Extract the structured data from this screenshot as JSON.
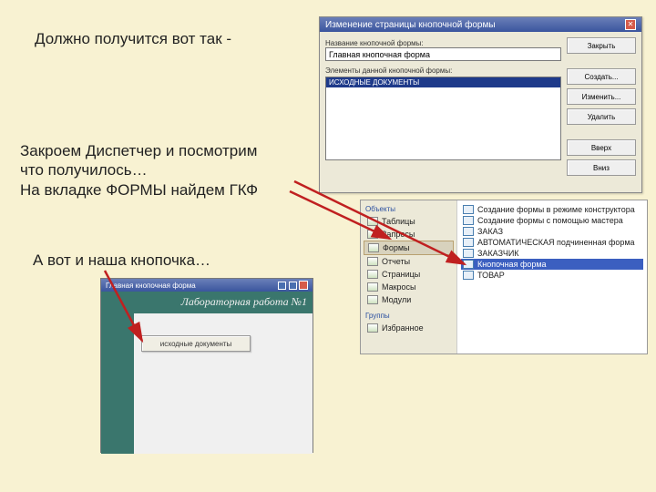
{
  "text": {
    "line1": "Должно получится вот так -",
    "line2a": "Закроем Диспетчер и посмотрим",
    "line2b": "что получилось…",
    "line2c": "На вкладке ФОРМЫ найдем ГКФ",
    "line3": "А вот и наша кнопочка…"
  },
  "dialog": {
    "title": "Изменение страницы кнопочной формы",
    "label1": "Название кнопочной формы:",
    "value1": "Главная кнопочная форма",
    "label2": "Элементы данной кнопочной формы:",
    "listItem": "ИСХОДНЫЕ ДОКУМЕНТЫ",
    "buttons": [
      "Закрыть",
      "Создать...",
      "Изменить...",
      "Удалить",
      "Вверх",
      "Вниз"
    ]
  },
  "db": {
    "leftHeader": "Объекты",
    "leftItems": [
      "Таблицы",
      "Запросы",
      "Формы",
      "Отчеты",
      "Страницы",
      "Макросы",
      "Модули"
    ],
    "leftGroups": "Группы",
    "leftFav": "Избранное",
    "rightItems": [
      "Создание формы в режиме конструктора",
      "Создание формы с помощью мастера",
      "ЗАКАЗ",
      "АВТОМАТИЧЕСКАЯ подчиненная форма",
      "ЗАКАЗЧИК",
      "Кнопочная форма",
      "ТОВАР"
    ]
  },
  "formWin": {
    "title": "Главная кнопочная форма",
    "header": "Лабораторная работа №1",
    "button": "исходные документы"
  }
}
